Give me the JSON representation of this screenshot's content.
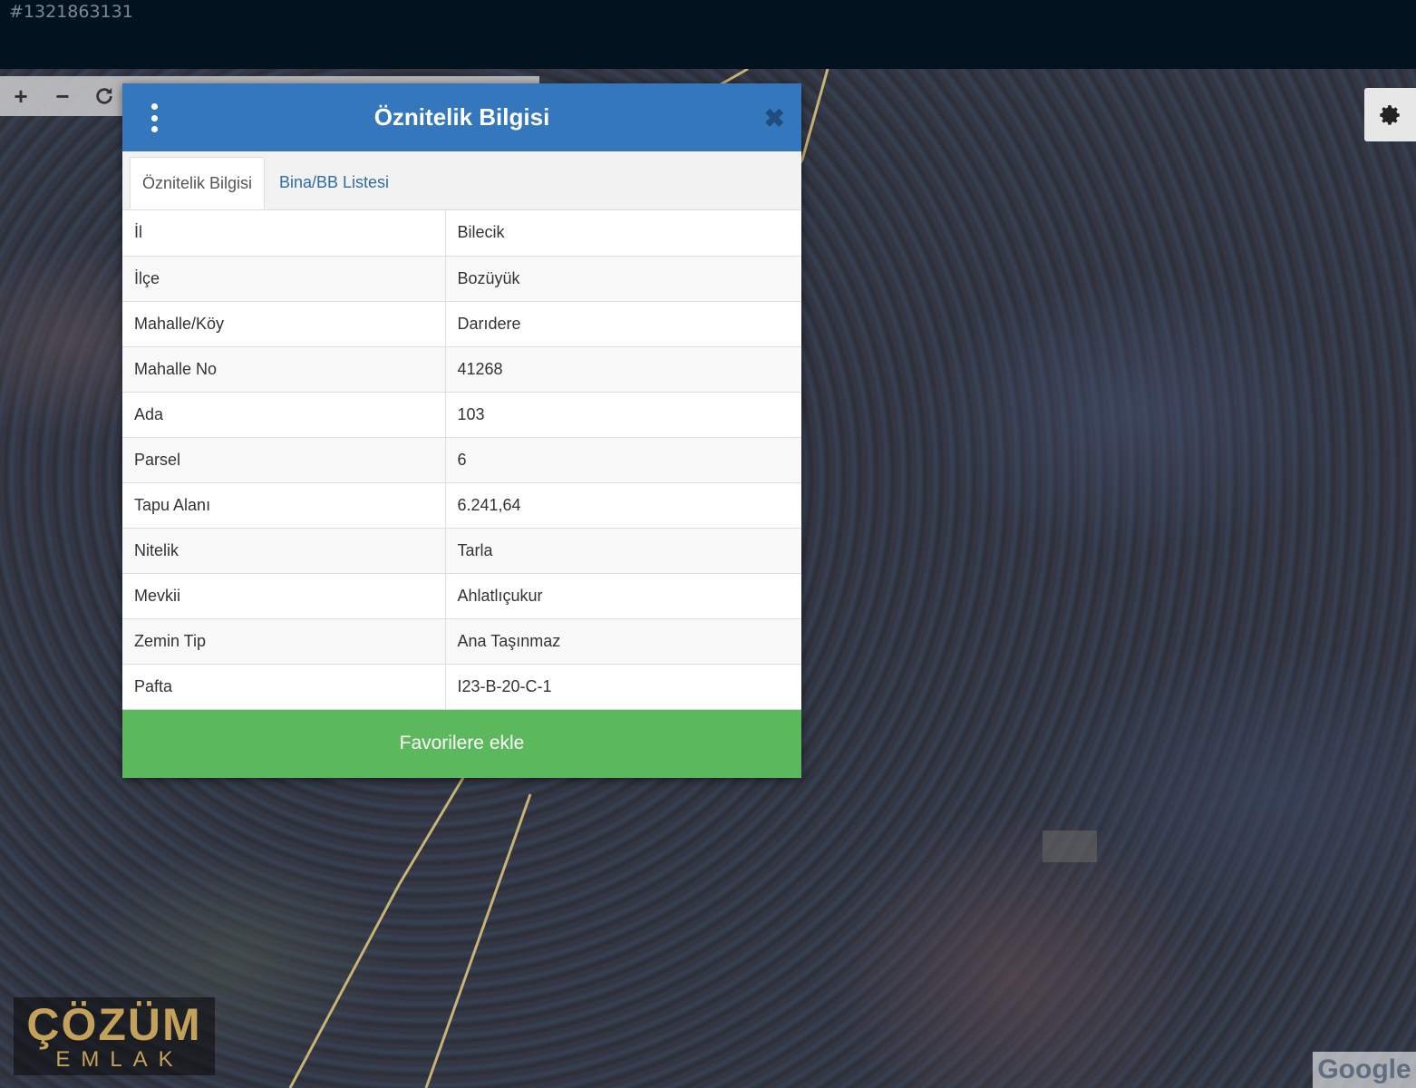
{
  "listing_id": "#1321863131",
  "map_tools": {
    "zoom_in": "+",
    "zoom_out": "−",
    "refresh_icon": "refresh-icon"
  },
  "dialog": {
    "title": "Öznitelik Bilgisi",
    "close": "✖",
    "tabs": [
      {
        "label": "Öznitelik Bilgisi",
        "active": true
      },
      {
        "label": "Bina/BB Listesi",
        "active": false
      }
    ],
    "rows": [
      {
        "key": "İl",
        "value": "Bilecik"
      },
      {
        "key": "İlçe",
        "value": "Bozüyük"
      },
      {
        "key": "Mahalle/Köy",
        "value": "Darıdere"
      },
      {
        "key": "Mahalle No",
        "value": "41268"
      },
      {
        "key": "Ada",
        "value": "103"
      },
      {
        "key": "Parsel",
        "value": "6"
      },
      {
        "key": "Tapu Alanı",
        "value": "6.241,64"
      },
      {
        "key": "Nitelik",
        "value": "Tarla"
      },
      {
        "key": "Mevkii",
        "value": "Ahlatlıçukur"
      },
      {
        "key": "Zemin Tip",
        "value": "Ana Taşınmaz"
      },
      {
        "key": "Pafta",
        "value": "I23-B-20-C-1"
      }
    ],
    "favorite_button": "Favorilere ekle"
  },
  "watermark": {
    "brand_line1": "ÇÖZÜM",
    "brand_line2": "EMLAK"
  },
  "map_attribution": "Google",
  "colors": {
    "header_blue": "#3577bd",
    "button_green": "#5cb85c",
    "tab_link": "#2e6da4",
    "brand_gold": "#c4a15a"
  }
}
